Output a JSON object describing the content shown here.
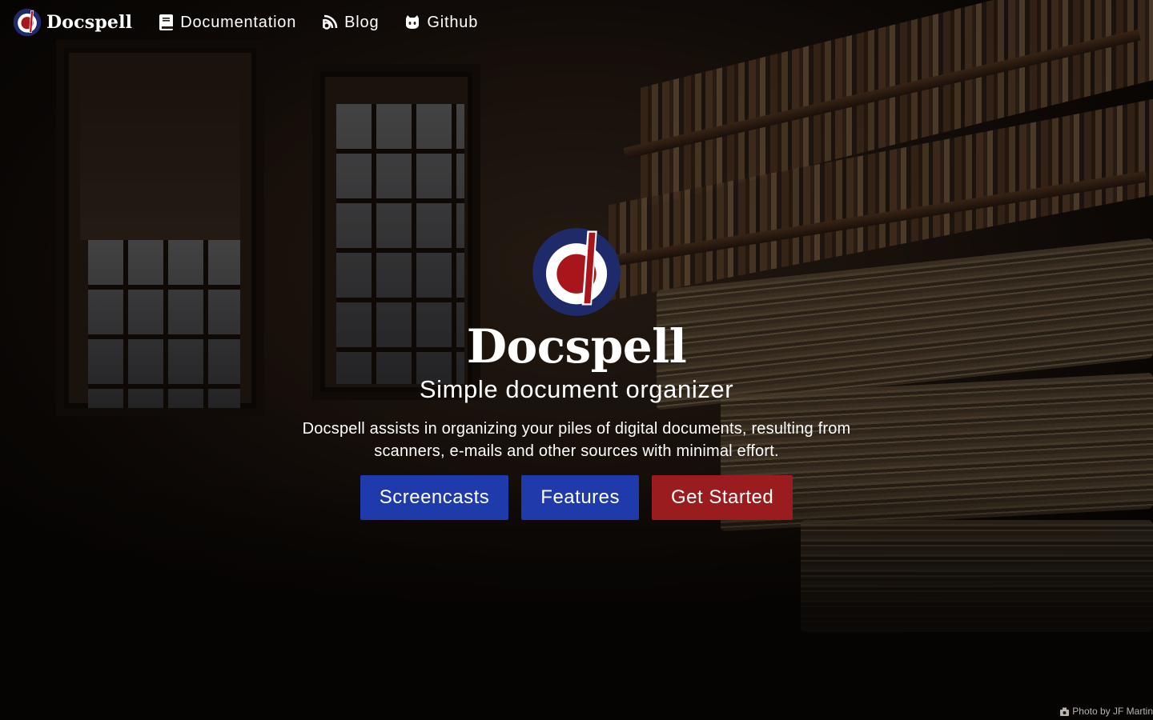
{
  "navbar": {
    "brand": {
      "name": "Docspell",
      "logo_icon": "docspell-logo-icon"
    },
    "items": [
      {
        "label": "Documentation",
        "icon": "book-icon"
      },
      {
        "label": "Blog",
        "icon": "rss-blog-icon"
      },
      {
        "label": "Github",
        "icon": "github-icon"
      }
    ]
  },
  "hero": {
    "logo_icon": "docspell-logo-icon",
    "title": "Docspell",
    "subtitle": "Simple document organizer",
    "description": "Docspell assists in organizing your piles of digital documents, resulting from scanners, e-mails and other sources with minimal effort.",
    "buttons": [
      {
        "label": "Screencasts",
        "color": "#1f3aab"
      },
      {
        "label": "Features",
        "color": "#1f3aab"
      },
      {
        "label": "Get Started",
        "color": "#9b1c1f"
      }
    ]
  },
  "photo_credit": {
    "text": "Photo by JF Martin",
    "icon": "camera-icon"
  },
  "colors": {
    "logo_ring": "#1f2a6b",
    "logo_accent": "#a8161c",
    "primary_button": "#1f3aab",
    "accent_button": "#9b1c1f"
  }
}
